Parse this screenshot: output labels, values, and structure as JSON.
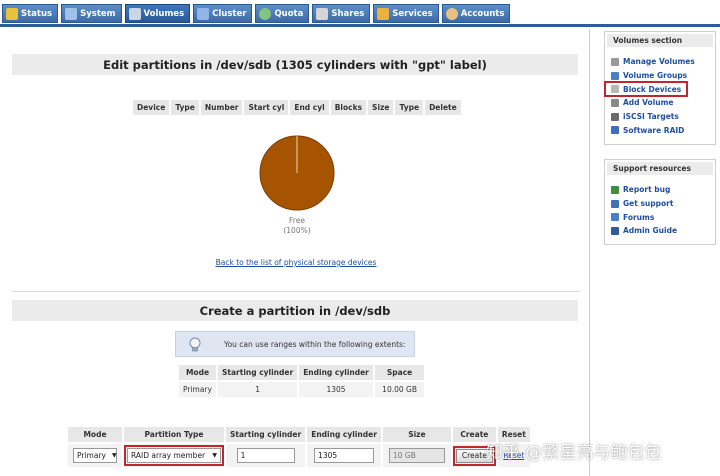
{
  "tabs": [
    {
      "label": "Status",
      "icon": "status-icon",
      "color": "#e8c23a"
    },
    {
      "label": "System",
      "icon": "system-icon",
      "color": "#9fc3e8"
    },
    {
      "label": "Volumes",
      "icon": "volumes-icon",
      "color": "#c9d6e6",
      "active": true
    },
    {
      "label": "Cluster",
      "icon": "cluster-icon",
      "color": "#8fb6e6"
    },
    {
      "label": "Quota",
      "icon": "quota-icon",
      "color": "#7fc47f"
    },
    {
      "label": "Shares",
      "icon": "shares-icon",
      "color": "#d5d5d5"
    },
    {
      "label": "Services",
      "icon": "services-icon",
      "color": "#e9b23a"
    },
    {
      "label": "Accounts",
      "icon": "accounts-icon",
      "color": "#e8c080"
    }
  ],
  "edit": {
    "title": "Edit partitions in /dev/sdb (1305 cylinders with \"gpt\" label)",
    "columns": [
      "Device",
      "Type",
      "Number",
      "Start cyl",
      "End cyl",
      "Blocks",
      "Size",
      "Type",
      "Delete"
    ],
    "pie": {
      "label": "Free",
      "percent_label": "(100%)",
      "value": 100,
      "color": "#a75400"
    },
    "back_link": "Back to the list of physical storage devices"
  },
  "create": {
    "title": "Create a partition in /dev/sdb",
    "info": "You can use ranges within the following extents:",
    "extents": {
      "columns": [
        "Mode",
        "Starting cylinder",
        "Ending cylinder",
        "Space"
      ],
      "row": [
        "Primary",
        "1",
        "1305",
        "10.00 GB"
      ]
    },
    "form": {
      "columns": [
        "Mode",
        "Partition Type",
        "Starting cylinder",
        "Ending cylinder",
        "Size",
        "Create",
        "Reset"
      ],
      "mode_value": "Primary",
      "partition_type_value": "RAID array member",
      "start_value": "1",
      "end_value": "1305",
      "size_value": "10 GB",
      "create_label": "Create",
      "reset_label": "Reset"
    }
  },
  "sidebar": {
    "volumes": {
      "title": "Volumes section",
      "items": [
        {
          "label": "Manage Volumes",
          "icon": "manage-volumes-icon",
          "color": "#9a9a9a"
        },
        {
          "label": "Volume Groups",
          "icon": "volume-groups-icon",
          "color": "#4a7fc1"
        },
        {
          "label": "Block Devices",
          "icon": "block-devices-icon",
          "color": "#b8b8b8"
        },
        {
          "label": "Add Volume",
          "icon": "add-volume-icon",
          "color": "#8a8a8a"
        },
        {
          "label": "iSCSI Targets",
          "icon": "iscsi-targets-icon",
          "color": "#6a6a6a"
        },
        {
          "label": "Software RAID",
          "icon": "software-raid-icon",
          "color": "#3f6fb5"
        }
      ]
    },
    "support": {
      "title": "Support resources",
      "items": [
        {
          "label": "Report bug",
          "icon": "bug-icon",
          "color": "#3f8f3f"
        },
        {
          "label": "Get support",
          "icon": "support-icon",
          "color": "#3f6fb5"
        },
        {
          "label": "Forums",
          "icon": "forums-icon",
          "color": "#4a7fc1"
        },
        {
          "label": "Admin Guide",
          "icon": "guide-icon",
          "color": "#2f5d99"
        }
      ]
    }
  },
  "watermark": "知乎 @繁星亮与鲍包包"
}
